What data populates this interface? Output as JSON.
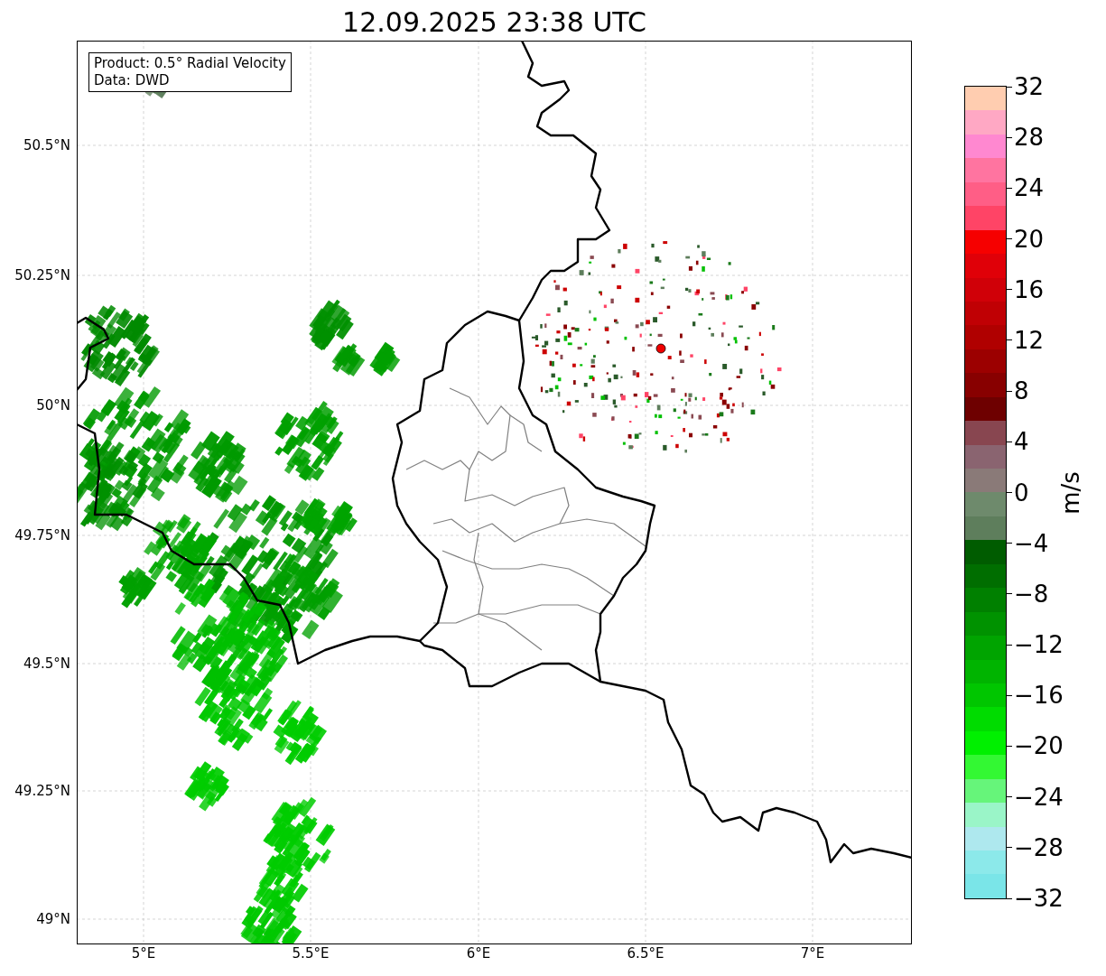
{
  "figure": {
    "title": "12.09.2025 23:38 UTC"
  },
  "map": {
    "legend": [
      "Product: 0.5° Radial Velocity",
      "Data: DWD"
    ],
    "lat_ticks": [
      "50.5°N",
      "50.25°N",
      "50°N",
      "49.75°N",
      "49.5°N",
      "49.25°N",
      "49°N"
    ],
    "lon_ticks": [
      "5°E",
      "5.5°E",
      "6°E",
      "6.5°E",
      "7°E"
    ]
  },
  "colorbar": {
    "label": "m/s",
    "ticks": [
      "32",
      "28",
      "24",
      "20",
      "16",
      "12",
      "8",
      "4",
      "0",
      "−4",
      "−8",
      "−12",
      "−16",
      "−20",
      "−24",
      "−28",
      "−32"
    ],
    "bins": [
      {
        "color": "#ffcdb0"
      },
      {
        "color": "#ffa8c4"
      },
      {
        "color": "#ff88d0"
      },
      {
        "color": "#ff74a0"
      },
      {
        "color": "#ff5e86"
      },
      {
        "color": "#ff4466"
      },
      {
        "color": "#f60000"
      },
      {
        "color": "#e00008"
      },
      {
        "color": "#d00008"
      },
      {
        "color": "#c00004"
      },
      {
        "color": "#b00000"
      },
      {
        "color": "#9c0000"
      },
      {
        "color": "#880000"
      },
      {
        "color": "#6e0000"
      },
      {
        "color": "#884650"
      },
      {
        "color": "#8a6470"
      },
      {
        "color": "#8a7a78"
      },
      {
        "color": "#6e8a6c"
      },
      {
        "color": "#5e7e5c"
      },
      {
        "color": "#005c00"
      },
      {
        "color": "#006e00"
      },
      {
        "color": "#008000"
      },
      {
        "color": "#009200"
      },
      {
        "color": "#00a400"
      },
      {
        "color": "#00b400"
      },
      {
        "color": "#00c600"
      },
      {
        "color": "#00dc00"
      },
      {
        "color": "#00f000"
      },
      {
        "color": "#33f833"
      },
      {
        "color": "#66f57a"
      },
      {
        "color": "#9af5c8"
      },
      {
        "color": "#aee8ee"
      },
      {
        "color": "#8ce9ea"
      },
      {
        "color": "#7ae5e8"
      }
    ]
  }
}
